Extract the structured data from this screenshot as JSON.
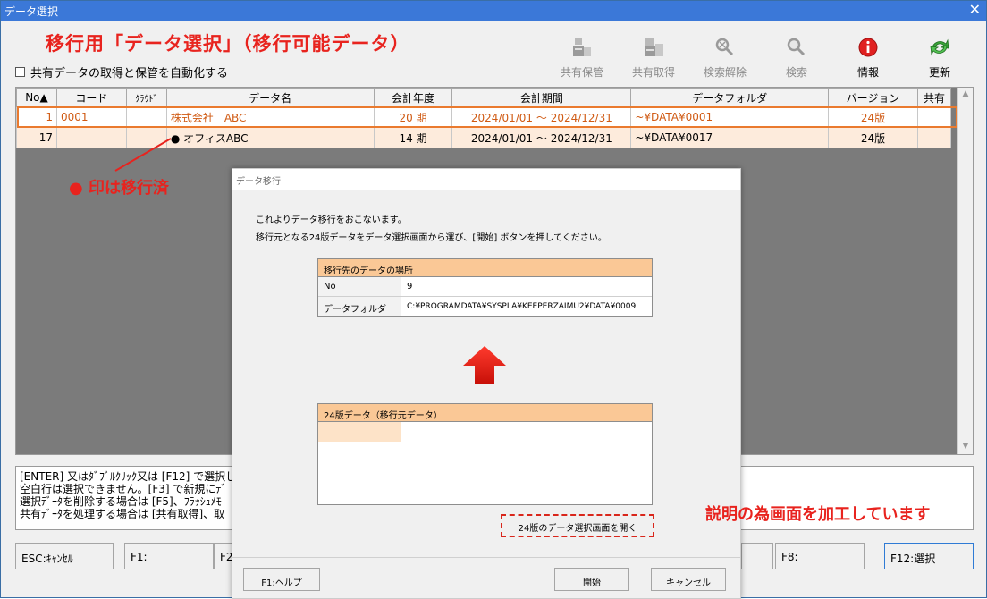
{
  "window": {
    "title": "データ選択",
    "close_glyph": "✕"
  },
  "heading": "移行用「データ選択」（移行可能データ）",
  "auto_checkbox": {
    "label": "共有データの取得と保管を自動化する",
    "checked": false
  },
  "toolbar": [
    {
      "label": "共有保管",
      "icon": "shared-save-icon",
      "enabled": false
    },
    {
      "label": "共有取得",
      "icon": "shared-get-icon",
      "enabled": false
    },
    {
      "label": "検索解除",
      "icon": "search-clear-icon",
      "enabled": false
    },
    {
      "label": "検索",
      "icon": "search-icon",
      "enabled": false
    },
    {
      "label": "情報",
      "icon": "info-icon",
      "enabled": true
    },
    {
      "label": "更新",
      "icon": "refresh-icon",
      "enabled": true
    }
  ],
  "table": {
    "headers": [
      "No▲",
      "コード",
      "ｸﾗｳﾄﾞ",
      "データ名",
      "会計年度",
      "会計期間",
      "データフォルダ",
      "バージョン",
      "共有"
    ],
    "rows": [
      {
        "no": "1",
        "code": "0001",
        "cloud": "",
        "name": "株式会社　ABC",
        "year": "20 期",
        "period": "2024/01/01 ～ 2024/12/31",
        "folder": "~¥DATA¥0001",
        "version": "24版",
        "shared": ""
      },
      {
        "no": "17",
        "code": "",
        "cloud": "",
        "name": "オフィスABC",
        "migrated_mark": "●",
        "year": "14 期",
        "period": "2024/01/01 ～ 2024/12/31",
        "folder": "~¥DATA¥0017",
        "version": "24版",
        "shared": ""
      }
    ]
  },
  "annotations": {
    "migrated_note": "● 印は移行済",
    "edited_note": "説明の為画面を加工しています"
  },
  "help_lines": [
    "[ENTER] 又はﾀﾞﾌﾞﾙｸﾘｯｸ又は [F12] で選択し",
    "空白行は選択できません。[F3] で新規にﾃﾞ",
    "選択ﾃﾞｰﾀを削除する場合は [F5]、ﾌﾗｯｼｭﾒﾓ",
    "共有ﾃﾞｰﾀを処理する場合は [共有取得]、取"
  ],
  "fkeys": {
    "esc": "ESC:ｷｬﾝｾﾙ",
    "f1": "F1:",
    "f2": "F2",
    "f8": "F8:",
    "f12": "F12:選択"
  },
  "dialog": {
    "title": "データ移行",
    "intro1": "これよりデータ移行をおこないます。",
    "intro2": "移行元となる24版データをデータ選択画面から選び、[開始] ボタンを押してください。",
    "dest": {
      "header": "移行先のデータの場所",
      "no_label": "No",
      "no_value": "9",
      "folder_label": "データフォルダ",
      "folder_value": "C:¥PROGRAMDATA¥SYSPLA¥KEEPERZAIMU2¥DATA¥0009"
    },
    "src": {
      "header": "24版データ（移行元データ）"
    },
    "open_button": "24版のデータ選択画面を開く",
    "help_button": "F1:ヘルプ",
    "start_button": "開始",
    "cancel_button": "キャンセル"
  }
}
